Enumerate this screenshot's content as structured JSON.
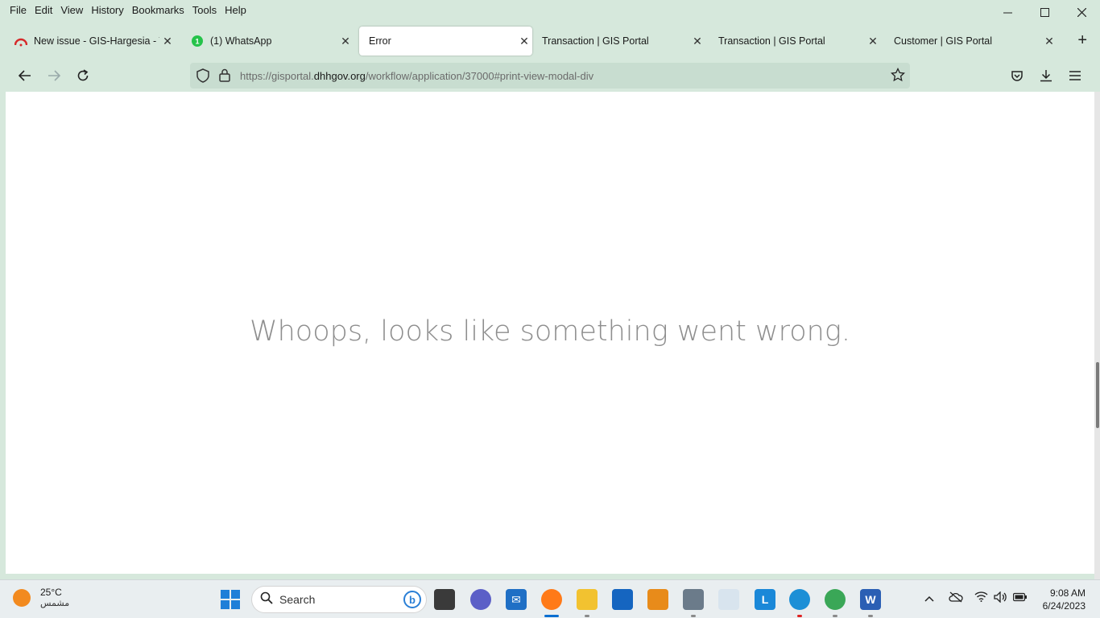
{
  "menubar": {
    "file": "File",
    "edit": "Edit",
    "view": "View",
    "history": "History",
    "bookmarks": "Bookmarks",
    "tools": "Tools",
    "help": "Help"
  },
  "tabs": [
    {
      "title": "New issue - GIS-Hargesia - Tea",
      "icon": "gitlab-icon"
    },
    {
      "title": "(1) WhatsApp",
      "icon": "whatsapp-icon",
      "badge": "1"
    },
    {
      "title": "Error",
      "icon": "",
      "active": true
    },
    {
      "title": "Transaction | GIS Portal",
      "icon": ""
    },
    {
      "title": "Transaction | GIS Portal",
      "icon": ""
    },
    {
      "title": "Customer | GIS Portal",
      "icon": ""
    }
  ],
  "urlbar": {
    "prefix": "https://gisportal.",
    "domain": "dhhgov.org",
    "path": "/workflow/application/37000#print-view-modal-div"
  },
  "page": {
    "message": "Whoops, looks like something went wrong."
  },
  "taskbar": {
    "weather_temp": "25°C",
    "weather_desc": "مشمس",
    "search_label": "Search",
    "time": "9:08 AM",
    "date": "6/24/2023"
  },
  "colors": {
    "frame": "#d6e8dc",
    "urlbar": "#c8ddd0",
    "message": "#8e8e8e",
    "accent": "#0a6ed1"
  }
}
